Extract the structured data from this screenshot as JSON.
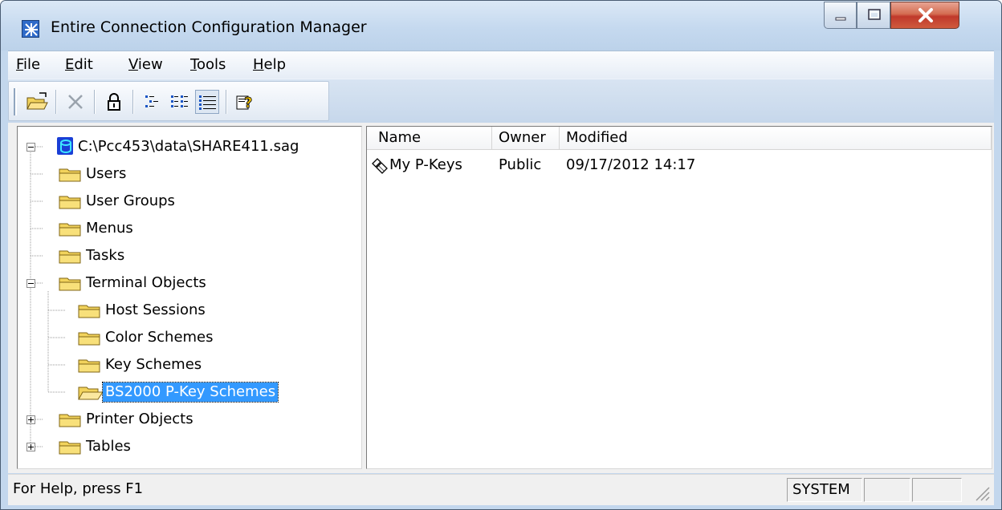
{
  "window": {
    "title": "Entire Connection Configuration Manager"
  },
  "menu": [
    {
      "label": "File",
      "mnemonic": "F",
      "rest": "ile"
    },
    {
      "label": "Edit",
      "mnemonic": "E",
      "rest": "dit"
    },
    {
      "label": "View",
      "mnemonic": "V",
      "rest": "iew"
    },
    {
      "label": "Tools",
      "mnemonic": "T",
      "rest": "ools"
    },
    {
      "label": "Help",
      "mnemonic": "H",
      "rest": "elp"
    }
  ],
  "toolbar": {
    "buttons": [
      {
        "name": "open",
        "icon": "open-folder-icon"
      },
      {
        "name": "delete",
        "icon": "delete-x-icon"
      },
      {
        "name": "lock",
        "icon": "lock-icon"
      },
      {
        "name": "large-icons",
        "icon": "large-icons-view-icon"
      },
      {
        "name": "list",
        "icon": "list-view-icon"
      },
      {
        "name": "details",
        "icon": "details-view-icon",
        "pressed": true
      },
      {
        "name": "help",
        "icon": "help-pointer-icon"
      }
    ]
  },
  "tree": {
    "root": "C:\\Pcc453\\data\\SHARE411.sag",
    "nodes": [
      {
        "label": "Users"
      },
      {
        "label": "User Groups"
      },
      {
        "label": "Menus"
      },
      {
        "label": "Tasks"
      },
      {
        "label": "Terminal Objects",
        "expanded": true
      },
      {
        "label": "Host Sessions"
      },
      {
        "label": "Color Schemes"
      },
      {
        "label": "Key Schemes"
      },
      {
        "label": "BS2000 P-Key Schemes",
        "selected": true
      },
      {
        "label": "Printer Objects",
        "expanded": false
      },
      {
        "label": "Tables",
        "expanded": false
      }
    ]
  },
  "list": {
    "columns": [
      "Name",
      "Owner",
      "Modified"
    ],
    "rows": [
      {
        "name": "My P-Keys",
        "owner": "Public",
        "modified": "09/17/2012 14:17",
        "icon": "key-scheme-icon"
      }
    ]
  },
  "status": {
    "help_text": "For Help, press F1",
    "user": "SYSTEM"
  },
  "colors": {
    "selection": "#3399ff",
    "folder": "#f2d35c"
  }
}
